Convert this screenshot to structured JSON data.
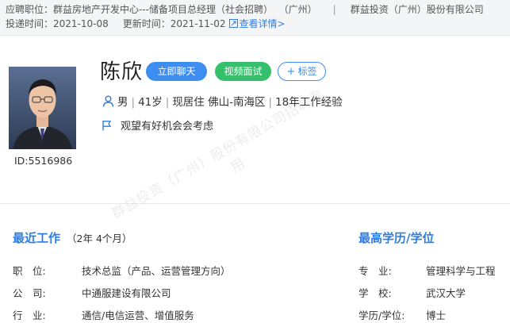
{
  "header": {
    "position_label": "应聘职位：",
    "position_value": "群益房地产开发中心---储备项目总经理（社会招聘）",
    "location": "（广州）",
    "separator": "|",
    "company": "群益投资（广州）股份有限公司",
    "submit_label": "投递时间：",
    "submit_date": "2021-10-08",
    "update_label": "更新时间：",
    "update_date": "2021-11-02",
    "detail_link": "查看详情>"
  },
  "profile": {
    "name": "陈欣",
    "id_text": "ID:5516986",
    "chat_button": "立即聊天",
    "video_button": "视频面试",
    "tag_button": "标签",
    "gender": "男",
    "age": "41岁",
    "residence": "现居住 佛山-南海区",
    "experience": "18年工作经验",
    "intent": "观望有好机会会考虑"
  },
  "work": {
    "title": "最近工作",
    "duration": "（2年 4个月）",
    "fields": [
      {
        "label": "职　位:",
        "value": "技术总监（产品、运营管理方向）"
      },
      {
        "label": "公　司:",
        "value": "中通服建设有限公司"
      },
      {
        "label": "行　业:",
        "value": "通信/电信运营、增值服务"
      }
    ]
  },
  "education": {
    "title": "最高学历/学位",
    "fields": [
      {
        "label": "专　业:",
        "value": "管理科学与工程"
      },
      {
        "label": "学　校:",
        "value": "武汉大学"
      },
      {
        "label": "学历/学位:",
        "value": "博士"
      }
    ]
  },
  "watermark": {
    "line1": "群益投资（广州）股份有限公司招聘专",
    "line2": "用"
  },
  "colors": {
    "accent": "#2f7de1",
    "chat": "#3d8ef0",
    "video": "#35c06c"
  }
}
